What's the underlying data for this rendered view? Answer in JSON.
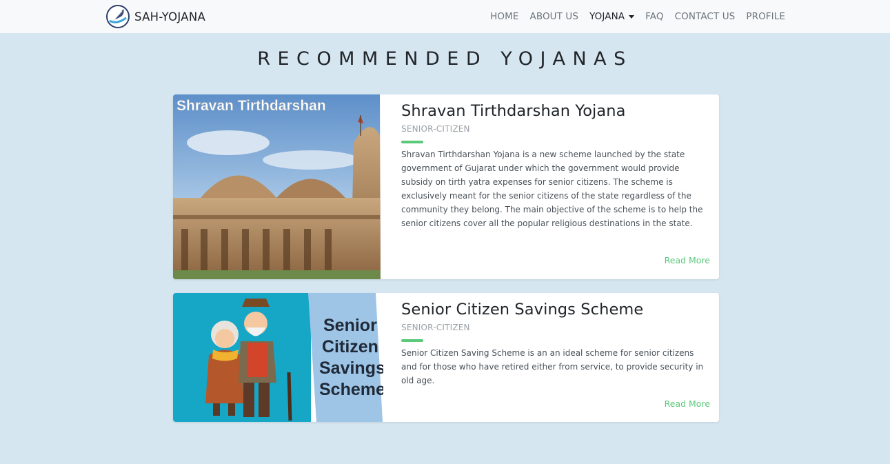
{
  "navbar": {
    "brand": "SAH-YOJANA",
    "items": [
      {
        "label": "HOME"
      },
      {
        "label": "ABOUT US"
      },
      {
        "label": "YOJANA"
      },
      {
        "label": "FAQ"
      },
      {
        "label": "CONTACT US"
      },
      {
        "label": "PROFILE"
      }
    ],
    "active_item": "YOJANA"
  },
  "main": {
    "title": "RECOMMENDED YOJANAS",
    "cards": [
      {
        "title": "Shravan Tirthdarshan Yojana",
        "category": "SENIOR-CITIZEN",
        "description": "Shravan Tirthdarshan Yojana is a new scheme launched by the state government of Gujarat under which the government would provide subsidy on tirth yatra expenses for senior citizens. The scheme is exclusively meant for the senior citizens of the state regardless of the community they belong. The main objective of the scheme is to help the senior citizens cover all the popular religious destinations in the state.",
        "read_more": "Read More",
        "image_caption": "Shravan Tirthdarshan"
      },
      {
        "title": "Senior Citizen Savings Scheme",
        "category": "SENIOR-CITIZEN",
        "description": "Senior Citizen Saving Scheme is an an ideal scheme for senior citizens and for those who have retired either from service, to provide security in old age.",
        "read_more": "Read More",
        "image_caption": [
          "Senior",
          "Citizen",
          "Savings",
          "Scheme"
        ]
      }
    ]
  },
  "colors": {
    "page_background": "#d6e6f1",
    "navbar_background": "#f8f9fa",
    "accent_green": "#5bc97a",
    "muted_text": "#9aa0a6"
  },
  "icons": {
    "brand_logo": "quill-circle-logo",
    "dropdown": "caret-down-icon"
  }
}
